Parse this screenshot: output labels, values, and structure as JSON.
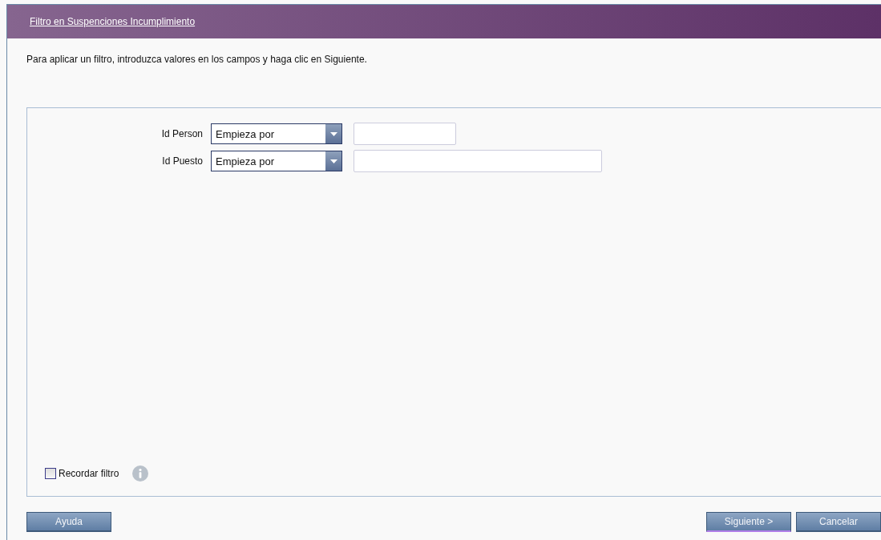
{
  "header": {
    "title": "Filtro en Suspenciones Incumplimiento"
  },
  "instruction": "Para aplicar un filtro, introduzca valores en los campos y haga clic en Siguiente.",
  "filters": [
    {
      "label": "Id Person",
      "operator": "Empieza por",
      "wide": false
    },
    {
      "label": "Id Puesto",
      "operator": "Empieza por",
      "wide": true
    }
  ],
  "remember": {
    "label": "Recordar filtro",
    "checked": false
  },
  "buttons_left": [
    {
      "label": "Ayuda",
      "focused": false
    }
  ],
  "buttons_right": [
    {
      "label": "Siguiente >",
      "focused": true
    },
    {
      "label": "Cancelar",
      "focused": false
    }
  ]
}
